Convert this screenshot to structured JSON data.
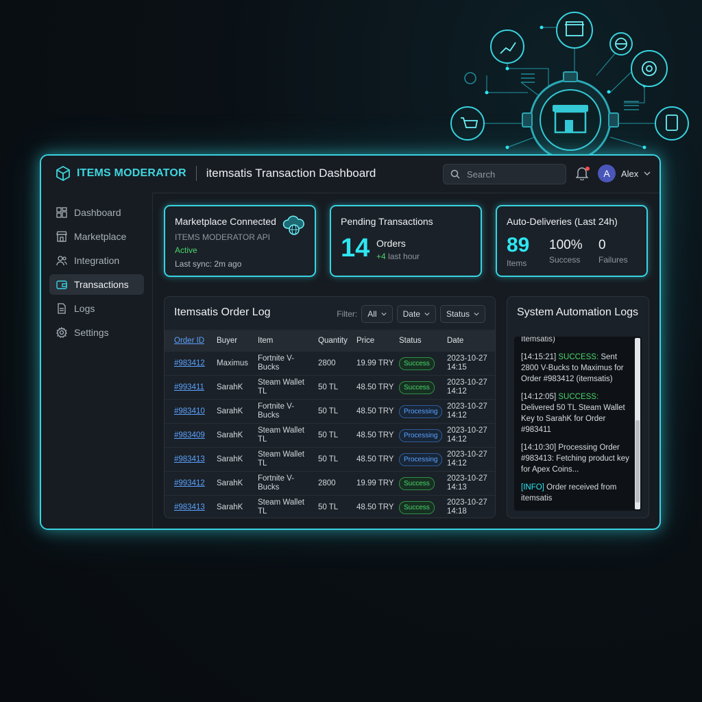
{
  "header": {
    "brand": "ITEMS MODERATOR",
    "title": "itemsatis Transaction Dashboard",
    "search_placeholder": "Search",
    "user_initial": "A",
    "user_name": "Alex"
  },
  "sidebar": {
    "items": [
      {
        "label": "Dashboard",
        "icon": "dashboard-icon"
      },
      {
        "label": "Marketplace",
        "icon": "store-icon"
      },
      {
        "label": "Integration",
        "icon": "users-icon"
      },
      {
        "label": "Transactions",
        "icon": "wallet-icon",
        "active": true
      },
      {
        "label": "Logs",
        "icon": "document-icon"
      },
      {
        "label": "Settings",
        "icon": "gear-icon"
      }
    ]
  },
  "cards": {
    "marketplace": {
      "title": "Marketplace Connected",
      "api": "ITEMS MODERATOR API",
      "status": "Active",
      "sync": "Last sync: 2m ago"
    },
    "pending": {
      "title": "Pending Transactions",
      "count": "14",
      "label": "Orders",
      "delta": "+4",
      "delta_label": "last hour"
    },
    "auto": {
      "title": "Auto-Deliveries (Last 24h)",
      "items_value": "89",
      "items_label": "Items",
      "success_value": "100%",
      "success_label": "Success",
      "failures_value": "0",
      "failures_label": "Failures"
    }
  },
  "order_log": {
    "title": "Itemsatis Order Log",
    "filter_label": "Filter:",
    "filters": [
      "All",
      "Date",
      "Status"
    ],
    "columns": [
      "Order ID",
      "Buyer",
      "Item",
      "Quantity",
      "Price",
      "Status",
      "Date"
    ],
    "rows": [
      {
        "id": "#983412",
        "buyer": "Maximus",
        "item": "Fortnite V-Bucks",
        "qty": "2800",
        "price": "19.99 TRY",
        "status": "Success",
        "date": "2023-10-27 14:15"
      },
      {
        "id": "#993411",
        "buyer": "SarahK",
        "item": "Steam Wallet TL",
        "qty": "50 TL",
        "price": "48.50 TRY",
        "status": "Success",
        "date": "2023-10-27 14:12"
      },
      {
        "id": "#983410",
        "buyer": "SarahK",
        "item": "Fortnite V-Bucks",
        "qty": "50 TL",
        "price": "48.50 TRY",
        "status": "Processing",
        "date": "2023-10-27 14:12"
      },
      {
        "id": "#983409",
        "buyer": "SarahK",
        "item": "Steam Wallet TL",
        "qty": "50 TL",
        "price": "48.50 TRY",
        "status": "Processing",
        "date": "2023-10-27 14:12"
      },
      {
        "id": "#983413",
        "buyer": "SarahK",
        "item": "Steam Wallet TL",
        "qty": "50 TL",
        "price": "48.50 TRY",
        "status": "Processing",
        "date": "2023-10-27 14:12"
      },
      {
        "id": "#993412",
        "buyer": "SarahK",
        "item": "Fortnite V-Bucks",
        "qty": "2800",
        "price": "19.99 TRY",
        "status": "Success",
        "date": "2023-10-27 14:13"
      },
      {
        "id": "#983413",
        "buyer": "SarahK",
        "item": "Steam Wallet TL",
        "qty": "50 TL",
        "price": "48.50 TRY",
        "status": "Success",
        "date": "2023-10-27 14:18"
      }
    ]
  },
  "system_logs": {
    "title": "System Automation Logs",
    "entries": [
      {
        "time": "",
        "tag": "",
        "text": "Itemsatis)"
      },
      {
        "time": "[14:15:21]",
        "tag": "SUCCESS:",
        "text": "Sent 2800 V-Bucks to Maximus for Order #983412 (itemsatis)"
      },
      {
        "time": "[14:12:05]",
        "tag": "SUCCESS:",
        "text": "Delivered 50 TL Steam Wallet Key to SarahK for Order #983411"
      },
      {
        "time": "[14:10:30]",
        "tag": "",
        "text": "Processing Order #983413: Fetching product key for Apex Coins..."
      },
      {
        "time": "",
        "tag": "[INFO]",
        "text": "Order received from itemsatis"
      }
    ]
  },
  "colors": {
    "accent": "#39d3e0",
    "success": "#4ad66d",
    "processing": "#5aa2ff",
    "background": "#0a1015"
  }
}
